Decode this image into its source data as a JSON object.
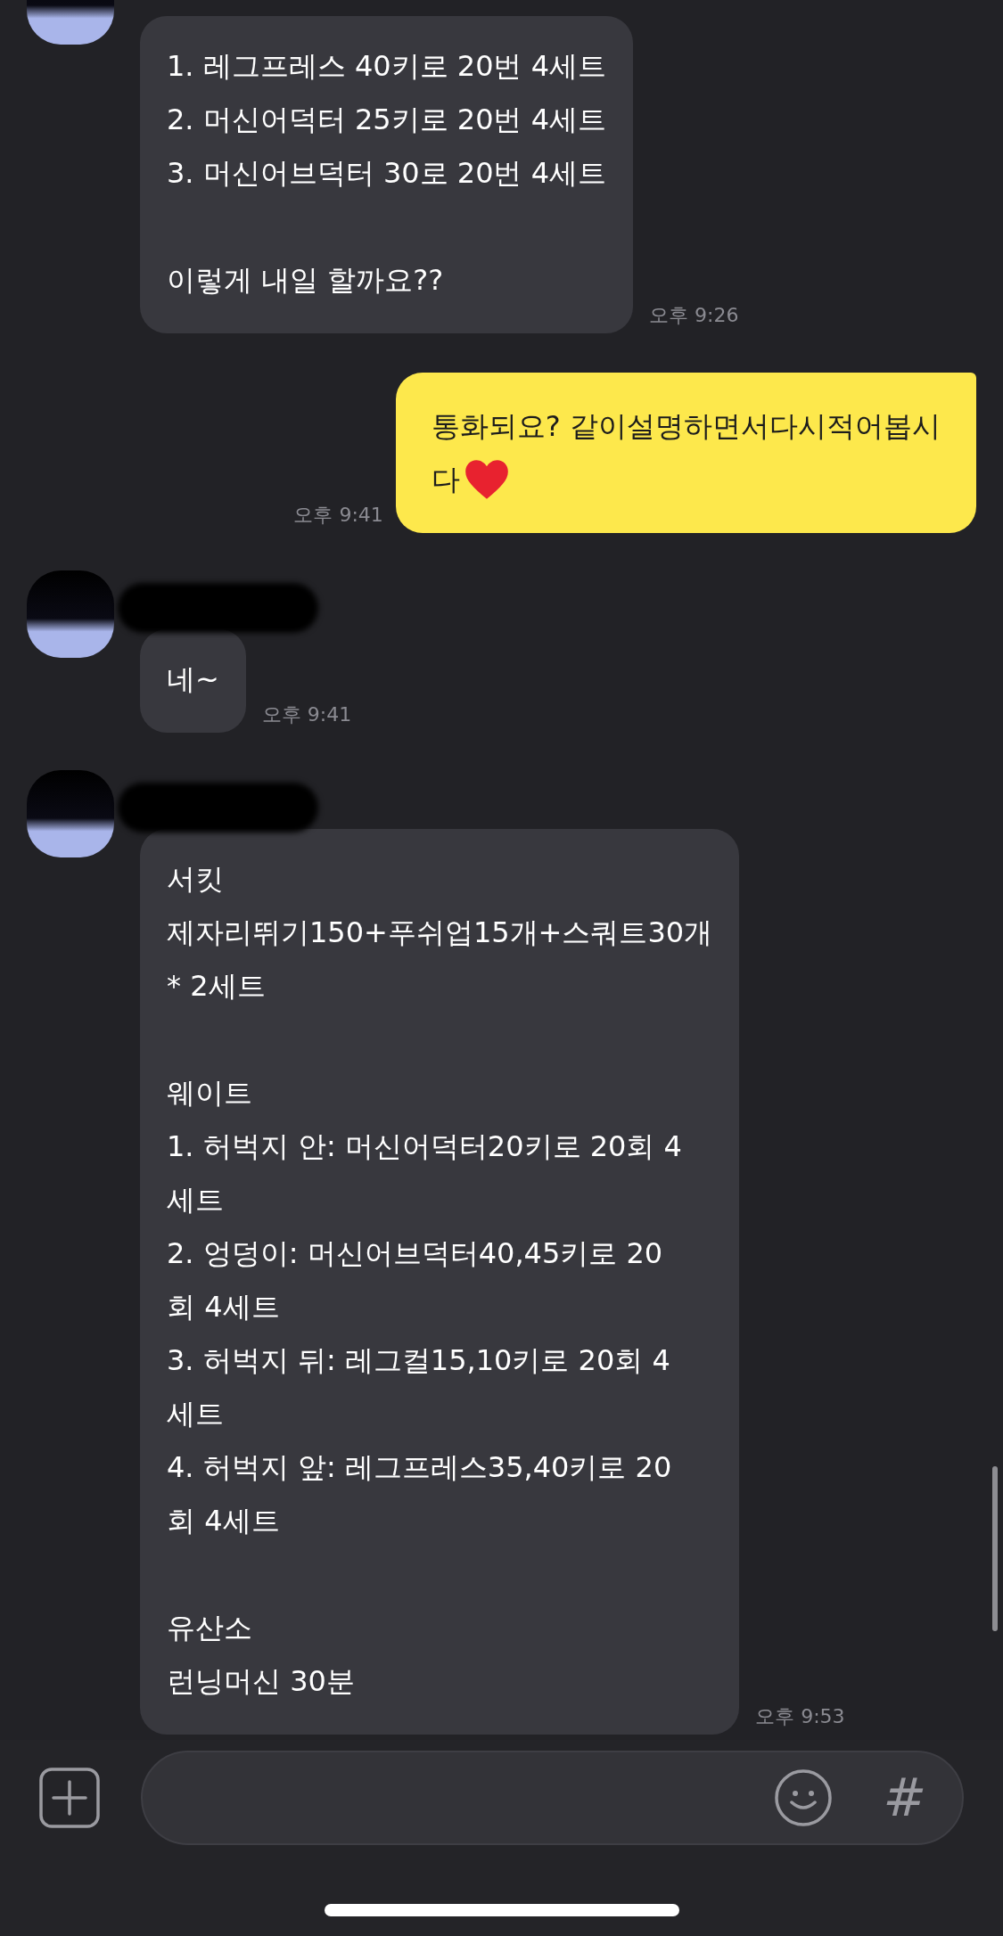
{
  "messages": [
    {
      "kind": "received",
      "avatar": true,
      "paragraphs": [
        [
          "1. 레그프레스 40키로 20번 4세트",
          "2. 머신어덕터 25키로 20번 4세트",
          "3. 머신어브덕터 30로 20번 4세트"
        ],
        [
          "이렇게 내일 할까요??"
        ]
      ],
      "time": "오후 9:26"
    },
    {
      "kind": "sent",
      "paragraphs": [
        [
          "통화되요? 같이설명하면서다시적어봅시",
          "다"
        ]
      ],
      "heart": true,
      "time": "오후 9:41"
    },
    {
      "kind": "received",
      "avatar": true,
      "name_redacted": true,
      "paragraphs": [
        [
          "네~"
        ]
      ],
      "time": "오후 9:41"
    },
    {
      "kind": "received",
      "avatar": true,
      "name_redacted": true,
      "paragraphs": [
        [
          "서킷",
          "제자리뛰기150+푸쉬업15개+스쿼트30개",
          "* 2세트"
        ],
        [
          "웨이트",
          "1. 허벅지 안: 머신어덕터20키로 20회 4",
          "세트",
          "2. 엉덩이: 머신어브덕터40,45키로 20",
          "회 4세트",
          "3. 허벅지 뒤: 레그컬15,10키로 20회 4",
          "세트",
          "4. 허벅지 앞: 레그프레스35,40키로 20",
          "회 4세트"
        ],
        [
          "유산소",
          "런닝머신 30분"
        ]
      ],
      "time": "오후 9:53"
    }
  ],
  "composer": {
    "hashtag": "#"
  }
}
